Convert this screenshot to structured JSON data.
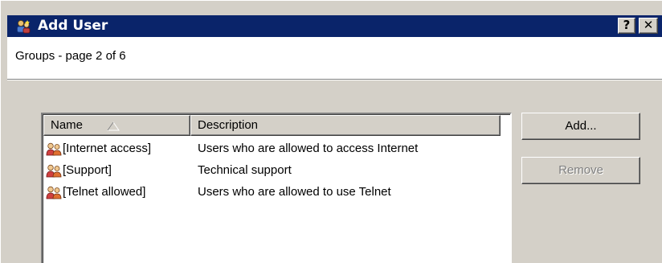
{
  "window": {
    "title": "Add User",
    "help_label": "?",
    "close_label": "✕"
  },
  "header": {
    "subtitle": "Groups - page 2 of 6"
  },
  "list": {
    "columns": [
      {
        "label": "Name",
        "sorted": "ascending"
      },
      {
        "label": "Description"
      }
    ],
    "rows": [
      {
        "name": "[Internet access]",
        "description": "Users who are allowed to access Internet",
        "icon": "user-group-icon"
      },
      {
        "name": "[Support]",
        "description": "Technical support",
        "icon": "user-group-icon"
      },
      {
        "name": "[Telnet allowed]",
        "description": "Users who are allowed to use Telnet",
        "icon": "user-group-icon"
      }
    ]
  },
  "buttons": {
    "add_label": "Add...",
    "remove_label": "Remove",
    "remove_enabled": false
  },
  "colors": {
    "titlebar": "#0a246a",
    "face": "#d4d0c8",
    "disabled_text": "#808080"
  }
}
